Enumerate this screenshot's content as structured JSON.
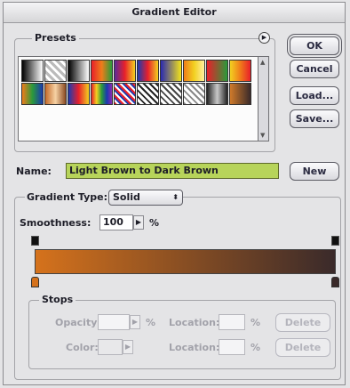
{
  "window": {
    "title": "Gradient Editor"
  },
  "presets": {
    "legend": "Presets",
    "menu_icon": "right-triangle-circle-icon",
    "swatches": [
      "linear-gradient(90deg,#000,#fff)",
      "repeating-linear-gradient(45deg,#bbb 0 3px,#fff 3px 6px)",
      "linear-gradient(90deg,#000,#fff)",
      "linear-gradient(90deg,#e8202a,#f07c1a,#2a9a3a)",
      "linear-gradient(90deg,#5a2a9a,#e8202a,#f2d020)",
      "linear-gradient(90deg,#1a3ab0,#e8202a,#f2d020)",
      "linear-gradient(90deg,#2a2ab0,#f2e21a)",
      "linear-gradient(90deg,#f07c1a,#f2d020,#fff0a0)",
      "linear-gradient(90deg,#e8202a,#2a9a3a)",
      "linear-gradient(90deg,#f2d020,#f07c1a,#e8202a)",
      "linear-gradient(90deg,#f07c1a,#2a9a3a,#1a3ab0)",
      "linear-gradient(90deg,#c46a2a,#f6d2a4,#8a4a22)",
      "linear-gradient(90deg,#1a3ab0,#e8202a,#f2d020)",
      "linear-gradient(90deg,#e8202a,#f2d020,#2a9a3a,#1a3ab0,#8a2ab0)",
      "repeating-linear-gradient(45deg,#e8202a 0 2px,#fff 2px 4px,#1a3ab0 4px 6px)",
      "repeating-linear-gradient(45deg,#222 0 2px,#fff 2px 5px)",
      "repeating-linear-gradient(45deg,#444 0 2px,#fff 2px 5px)",
      "repeating-linear-gradient(45deg,#888 0 2px,#fff 2px 5px)",
      "linear-gradient(90deg,#222,#c8c8c8,#222)",
      "linear-gradient(90deg,#d07a2a,#3a2a2a)"
    ]
  },
  "buttons": {
    "ok": "OK",
    "cancel": "Cancel",
    "load": "Load...",
    "save": "Save...",
    "new": "New",
    "delete_opacity": "Delete",
    "delete_color": "Delete"
  },
  "name": {
    "label": "Name:",
    "value": "Light Brown to Dark Brown"
  },
  "gradient_type": {
    "label": "Gradient Type:",
    "value": "Solid"
  },
  "smoothness": {
    "label": "Smoothness:",
    "value": "100",
    "unit": "%"
  },
  "gradient": {
    "start_color": "#d5721c",
    "end_color": "#3a2a2a"
  },
  "stops": {
    "legend": "Stops",
    "opacity_label": "Opacity:",
    "opacity_unit": "%",
    "location_label_1": "Location:",
    "location_unit_1": "%",
    "color_label": "Color:",
    "location_label_2": "Location:",
    "location_unit_2": "%"
  },
  "colors": {
    "name_field_bg": "#b7d45a",
    "window_bg": "#e4e4e6"
  }
}
